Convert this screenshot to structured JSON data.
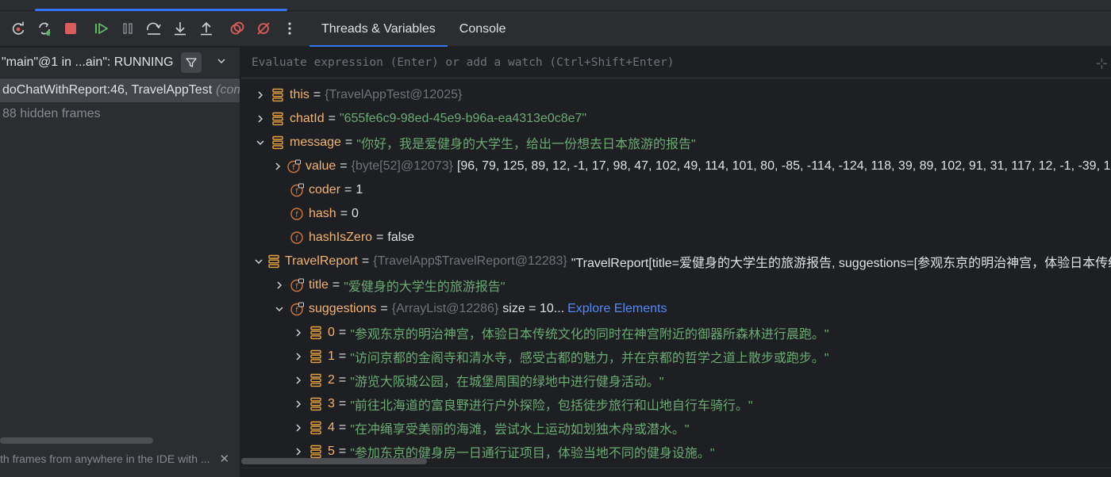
{
  "toolbar": {
    "icons": [
      "rerun-icon",
      "restart-icon",
      "stop-icon",
      "resume-icon",
      "pause-icon",
      "step-over-icon",
      "step-into-icon",
      "step-out-icon",
      "view-breakpoints-icon",
      "mute-breakpoints-icon",
      "more-icon"
    ],
    "colors": {
      "accent": "#3574f0",
      "green": "#5fb865",
      "red": "#db5c5c"
    }
  },
  "tabs": [
    {
      "label": "Threads & Variables",
      "active": true
    },
    {
      "label": "Console",
      "active": false
    }
  ],
  "threads": {
    "selected_thread": "\"main\"@1 in ...ain\": RUNNING",
    "frames": [
      {
        "method": "doChatWithReport:46, TravelAppTest",
        "location": "(com"
      }
    ],
    "hidden_frames": "88 hidden frames",
    "footer_hint": "th frames from anywhere in the IDE with ..."
  },
  "evaluate": {
    "placeholder": "Evaluate expression (Enter) or add a watch (Ctrl+Shift+Enter)"
  },
  "variables": [
    {
      "name": "this",
      "type": "{TravelAppTest@12025}",
      "value": "",
      "icon": "object-icon",
      "expand": "collapsed",
      "indent": 0,
      "kind": "type"
    },
    {
      "name": "chatId",
      "type": "",
      "value": "\"655fe6c9-98ed-45e9-b96a-ea4313e0c8e7\"",
      "icon": "object-icon",
      "expand": "collapsed",
      "indent": 0,
      "kind": "str"
    },
    {
      "name": "message",
      "type": "",
      "value": "\"你好，我是爱健身的大学生，给出一份想去日本旅游的报告\"",
      "icon": "object-icon",
      "expand": "expanded",
      "indent": 0,
      "kind": "str"
    },
    {
      "name": "value",
      "type": "{byte[52]@12073}",
      "value": "[96, 79, 125, 89, 12, -1, 17, 98, 47, 102, 49, 114, 101, 80, -85, -114, -124, 118, 39, 89, 102, 91, 31, 117, 12, -1, -39, 1...",
      "icon": "field-lock-icon",
      "expand": "collapsed",
      "indent": 1,
      "kind": "plain"
    },
    {
      "name": "coder",
      "type": "",
      "value": "1",
      "icon": "field-lock-icon",
      "expand": "none",
      "indent": 1,
      "kind": "plain"
    },
    {
      "name": "hash",
      "type": "",
      "value": "0",
      "icon": "field-icon",
      "expand": "none",
      "indent": 1,
      "kind": "plain"
    },
    {
      "name": "hashIsZero",
      "type": "",
      "value": "false",
      "icon": "field-icon",
      "expand": "none",
      "indent": 1,
      "kind": "plain"
    },
    {
      "name": "TravelReport",
      "type": "{TravelApp$TravelReport@12283}",
      "value": "\"TravelReport[title=爱健身的大学生的旅游报告, suggestions=[参观东京的明治神宫，体验日本传统文化",
      "icon": "object-icon",
      "expand": "expanded",
      "indent": 0,
      "kind": "plain"
    },
    {
      "name": "title",
      "type": "",
      "value": "\"爱健身的大学生的旅游报告\"",
      "icon": "field-lock-icon",
      "expand": "collapsed",
      "indent": 1,
      "kind": "str"
    },
    {
      "name": "suggestions",
      "type": "{ArrayList@12286}",
      "value": "size = 10...",
      "link": "Explore Elements",
      "icon": "field-lock-icon",
      "expand": "expanded",
      "indent": 1,
      "kind": "plain"
    },
    {
      "name": "0",
      "type": "",
      "value": "\"参观东京的明治神宫，体验日本传统文化的同时在神宫附近的御器所森林进行晨跑。\"",
      "icon": "object-icon",
      "expand": "collapsed",
      "indent": 2,
      "kind": "str"
    },
    {
      "name": "1",
      "type": "",
      "value": "\"访问京都的金阁寺和清水寺，感受古都的魅力，并在京都的哲学之道上散步或跑步。\"",
      "icon": "object-icon",
      "expand": "collapsed",
      "indent": 2,
      "kind": "str"
    },
    {
      "name": "2",
      "type": "",
      "value": "\"游览大阪城公园，在城堡周围的绿地中进行健身活动。\"",
      "icon": "object-icon",
      "expand": "collapsed",
      "indent": 2,
      "kind": "str"
    },
    {
      "name": "3",
      "type": "",
      "value": "\"前往北海道的富良野进行户外探险，包括徒步旅行和山地自行车骑行。\"",
      "icon": "object-icon",
      "expand": "collapsed",
      "indent": 2,
      "kind": "str"
    },
    {
      "name": "4",
      "type": "",
      "value": "\"在冲绳享受美丽的海滩，尝试水上运动如划独木舟或潜水。\"",
      "icon": "object-icon",
      "expand": "collapsed",
      "indent": 2,
      "kind": "str"
    },
    {
      "name": "5",
      "type": "",
      "value": "\"参加东京的健身房一日通行证项目，体验当地不同的健身设施。\"",
      "icon": "object-icon",
      "expand": "collapsed",
      "indent": 2,
      "kind": "str"
    }
  ]
}
